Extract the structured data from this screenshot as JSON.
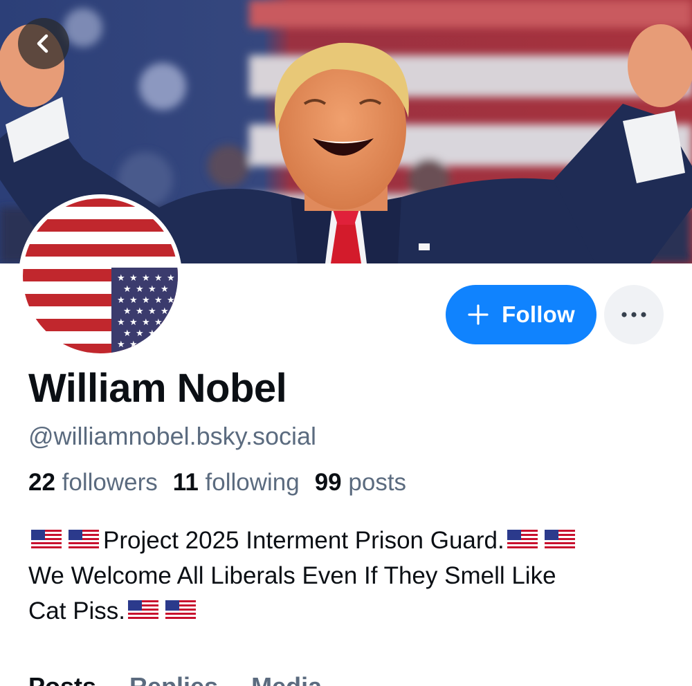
{
  "profile": {
    "display_name": "William Nobel",
    "handle": "@williamnobel.bsky.social",
    "bio": {
      "line1": "Project 2025 Interment Prison Guard.",
      "line2": "We Welcome All Liberals Even If They Smell Like",
      "line3": "Cat Piss."
    }
  },
  "stats": {
    "followers_count": "22",
    "followers_label": "followers",
    "following_count": "11",
    "following_label": "following",
    "posts_count": "99",
    "posts_label": "posts"
  },
  "actions": {
    "follow_label": "Follow",
    "more_icon": "ellipsis-icon",
    "back_icon": "chevron-left-icon"
  },
  "tabs": [
    {
      "label": "Posts",
      "active": true
    },
    {
      "label": "Replies",
      "active": false
    },
    {
      "label": "Media",
      "active": false
    }
  ],
  "colors": {
    "accent": "#1083fe",
    "text_primary": "#0b0f14",
    "text_secondary": "#5b6b7f",
    "more_button_bg": "#f0f2f5"
  }
}
